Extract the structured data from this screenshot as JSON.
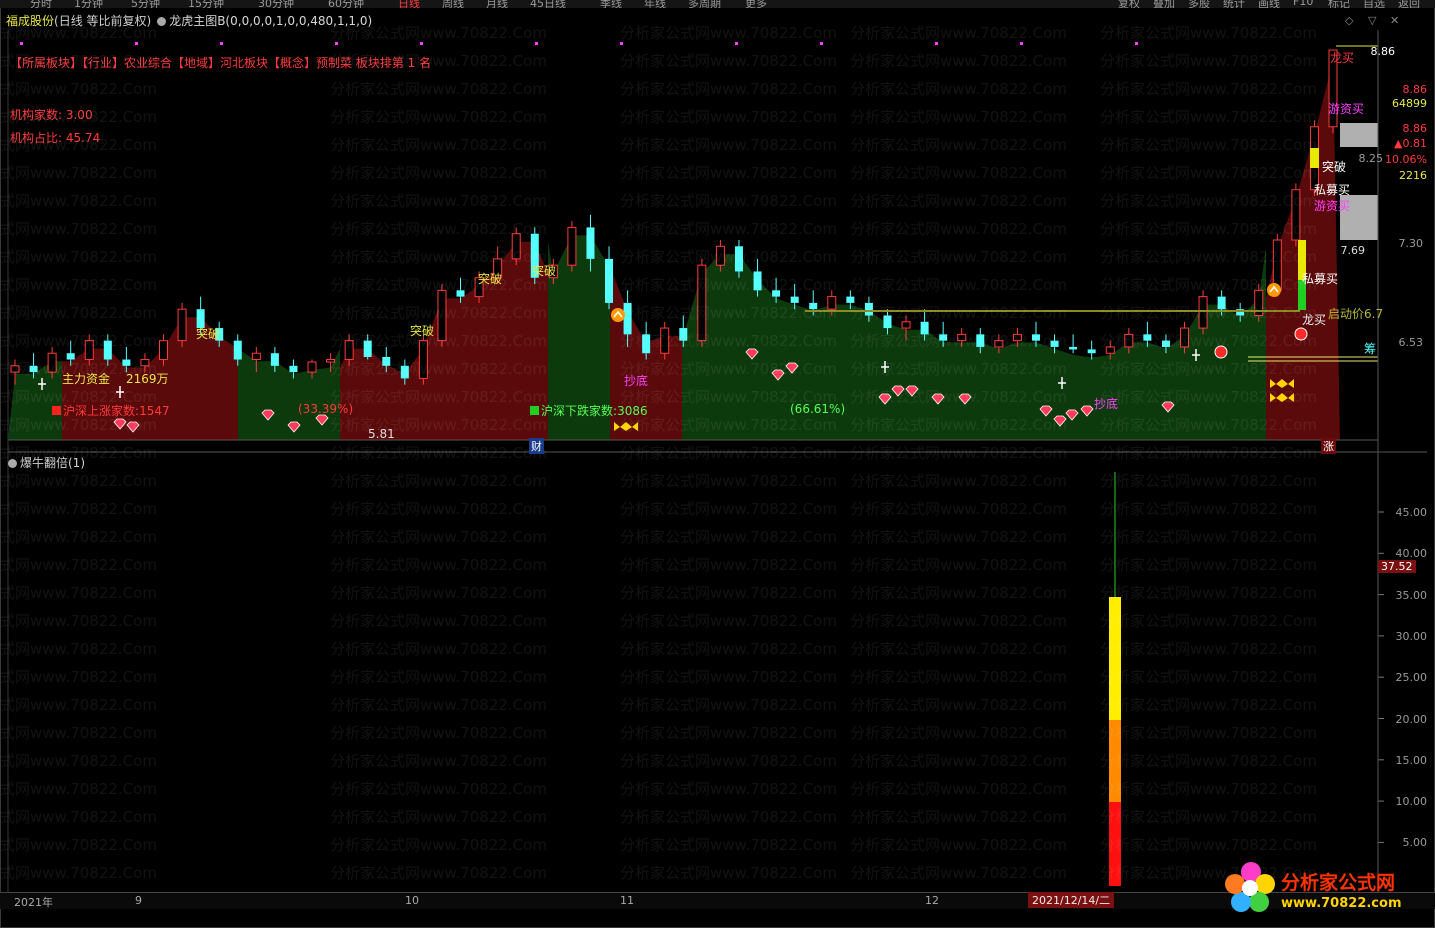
{
  "toolbar": {
    "items": [
      "分时",
      "1分钟",
      "5分钟",
      "15分钟",
      "30分钟",
      "60分钟",
      "日线",
      "周线",
      "月线",
      "45日线",
      "季线",
      "年线",
      "多周期",
      "更多"
    ],
    "right_items": [
      "复权",
      "叠加",
      "多股",
      "统计",
      "画线",
      "F10",
      "标记",
      "自选",
      "返回"
    ]
  },
  "header": {
    "stock_name": "福成股份",
    "chart_mode": "(日线 等比前复权)",
    "indicator": "龙虎主图B(0,0,0,0,1,0,0,480,1,1,0)"
  },
  "info": {
    "sector_line": "【所属板块】【行业】农业综合【地域】河北板块【概念】预制菜 板块排第 1 名",
    "inst_count": "机构家数: 3.00",
    "inst_ratio": "机构占比: 45.74"
  },
  "price_axis": {
    "labels": [
      "8.86",
      "8.25",
      "7.69",
      "7.30",
      "6.53"
    ],
    "right_panel": [
      "8.86",
      "64899",
      "8.86",
      "▲0.81",
      "10.06%",
      "2216"
    ]
  },
  "annotations": {
    "main_funds": "主力资金",
    "main_funds_value": "2169万",
    "hs_up_label": "沪深上涨家数",
    "hs_up_value": "1547",
    "hs_down_label": "沪深下跌家数",
    "hs_down_value": "3086",
    "pct_left": "(33.39%)",
    "pct_right": "(66.61%)",
    "low_value": "5.81",
    "breakout": "突破",
    "bottom_fish": "抄底",
    "dragon_buy": "龙买",
    "hot_money_buy": "游资买",
    "private_buy": "私募买",
    "start_price": "启动价6.7",
    "fin_tag": "财",
    "rise_tag": "涨",
    "chou_tag": "筹"
  },
  "lower_panel": {
    "title": "爆牛翻倍(1)",
    "current_value": "37.52",
    "axis_labels": [
      "45.00",
      "40.00",
      "35.00",
      "30.00",
      "25.00",
      "20.00",
      "15.00",
      "10.00",
      "5.00"
    ]
  },
  "time_axis": {
    "labels": [
      "2021年",
      "9",
      "10",
      "11",
      "12"
    ],
    "selected_date": "2021/12/14/二"
  },
  "logo": {
    "title": "分析家公式网",
    "url": "www.70822.com"
  },
  "watermark": "分析家公式网www.70822.Com",
  "colors": {
    "up": "#ff3a3a",
    "down": "#54ffff",
    "bg": "#000000",
    "green_area": "#0d3a0d",
    "red_area": "#5a0a0a"
  },
  "chart_data": {
    "type": "candlestick",
    "ylim": [
      5.8,
      8.9
    ],
    "candles": [
      [
        6.3,
        6.4,
        6.2,
        6.35
      ],
      [
        6.35,
        6.45,
        6.25,
        6.3
      ],
      [
        6.3,
        6.5,
        6.25,
        6.45
      ],
      [
        6.45,
        6.55,
        6.35,
        6.4
      ],
      [
        6.4,
        6.6,
        6.35,
        6.55
      ],
      [
        6.55,
        6.6,
        6.35,
        6.4
      ],
      [
        6.4,
        6.5,
        6.3,
        6.35
      ],
      [
        6.35,
        6.45,
        6.3,
        6.4
      ],
      [
        6.4,
        6.6,
        6.35,
        6.55
      ],
      [
        6.55,
        6.85,
        6.5,
        6.8
      ],
      [
        6.8,
        6.9,
        6.6,
        6.65
      ],
      [
        6.65,
        6.7,
        6.5,
        6.55
      ],
      [
        6.55,
        6.6,
        6.35,
        6.4
      ],
      [
        6.4,
        6.5,
        6.3,
        6.45
      ],
      [
        6.45,
        6.5,
        6.3,
        6.35
      ],
      [
        6.35,
        6.4,
        6.25,
        6.3
      ],
      [
        6.3,
        6.4,
        6.25,
        6.38
      ],
      [
        6.38,
        6.45,
        6.3,
        6.4
      ],
      [
        6.4,
        6.6,
        6.35,
        6.55
      ],
      [
        6.55,
        6.6,
        6.4,
        6.42
      ],
      [
        6.42,
        6.5,
        6.3,
        6.35
      ],
      [
        6.35,
        6.4,
        6.2,
        6.25
      ],
      [
        6.25,
        6.6,
        6.2,
        6.55
      ],
      [
        6.55,
        7.0,
        6.5,
        6.95
      ],
      [
        6.95,
        7.05,
        6.85,
        6.9
      ],
      [
        6.9,
        7.1,
        6.85,
        7.05
      ],
      [
        7.05,
        7.3,
        7.0,
        7.2
      ],
      [
        7.2,
        7.45,
        7.15,
        7.4
      ],
      [
        7.4,
        7.45,
        7.0,
        7.05
      ],
      [
        7.05,
        7.2,
        7.0,
        7.15
      ],
      [
        7.15,
        7.5,
        7.1,
        7.45
      ],
      [
        7.45,
        7.55,
        7.1,
        7.2
      ],
      [
        7.2,
        7.3,
        6.8,
        6.85
      ],
      [
        6.85,
        6.95,
        6.5,
        6.6
      ],
      [
        6.6,
        6.7,
        6.4,
        6.45
      ],
      [
        6.45,
        6.7,
        6.4,
        6.65
      ],
      [
        6.65,
        6.75,
        6.5,
        6.55
      ],
      [
        6.55,
        7.2,
        6.5,
        7.15
      ],
      [
        7.15,
        7.35,
        7.1,
        7.3
      ],
      [
        7.3,
        7.35,
        7.05,
        7.1
      ],
      [
        7.1,
        7.2,
        6.9,
        6.95
      ],
      [
        6.95,
        7.05,
        6.85,
        6.9
      ],
      [
        6.9,
        7.0,
        6.8,
        6.85
      ],
      [
        6.85,
        6.95,
        6.75,
        6.8
      ],
      [
        6.8,
        6.95,
        6.75,
        6.9
      ],
      [
        6.9,
        6.95,
        6.8,
        6.85
      ],
      [
        6.85,
        6.9,
        6.7,
        6.75
      ],
      [
        6.75,
        6.8,
        6.6,
        6.65
      ],
      [
        6.65,
        6.75,
        6.55,
        6.7
      ],
      [
        6.7,
        6.8,
        6.55,
        6.6
      ],
      [
        6.6,
        6.7,
        6.5,
        6.55
      ],
      [
        6.55,
        6.65,
        6.5,
        6.6
      ],
      [
        6.6,
        6.65,
        6.45,
        6.5
      ],
      [
        6.5,
        6.6,
        6.45,
        6.55
      ],
      [
        6.55,
        6.65,
        6.5,
        6.6
      ],
      [
        6.6,
        6.7,
        6.5,
        6.55
      ],
      [
        6.55,
        6.6,
        6.45,
        6.5
      ],
      [
        6.5,
        6.6,
        6.45,
        6.48
      ],
      [
        6.48,
        6.55,
        6.4,
        6.45
      ],
      [
        6.45,
        6.55,
        6.4,
        6.5
      ],
      [
        6.5,
        6.65,
        6.45,
        6.6
      ],
      [
        6.6,
        6.7,
        6.5,
        6.55
      ],
      [
        6.55,
        6.6,
        6.45,
        6.5
      ],
      [
        6.5,
        6.7,
        6.45,
        6.65
      ],
      [
        6.65,
        6.95,
        6.6,
        6.9
      ],
      [
        6.9,
        6.95,
        6.75,
        6.8
      ],
      [
        6.8,
        6.85,
        6.7,
        6.75
      ],
      [
        6.75,
        7.0,
        6.7,
        6.95
      ],
      [
        6.95,
        7.4,
        6.9,
        7.35
      ],
      [
        7.35,
        7.8,
        7.3,
        7.75
      ],
      [
        7.75,
        8.3,
        7.7,
        8.25
      ],
      [
        8.25,
        8.86,
        8.2,
        8.86
      ]
    ]
  }
}
